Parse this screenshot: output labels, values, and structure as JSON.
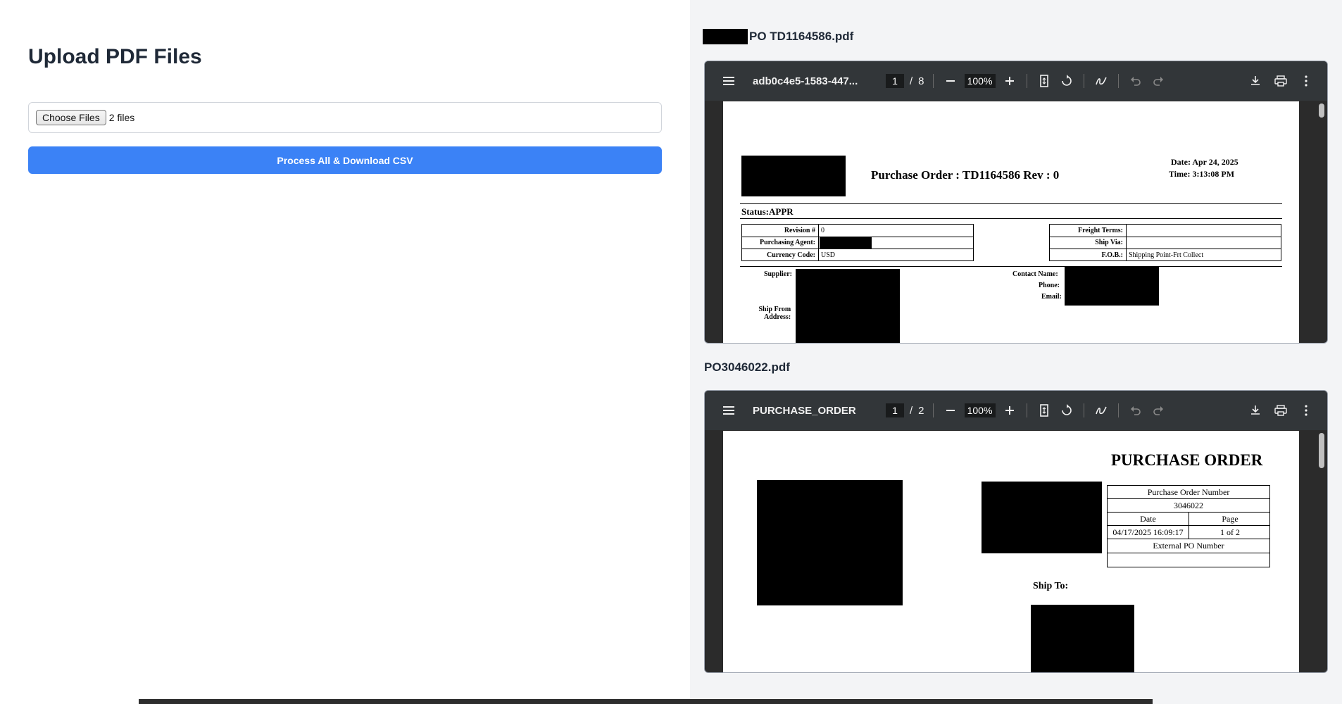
{
  "upload": {
    "title": "Upload PDF Files",
    "choose_label": "Choose Files",
    "file_count": "2 files",
    "process_label": "Process All & Download CSV"
  },
  "pdfs": [
    {
      "name": "PO TD1164586.pdf",
      "toolbar_title": "adb0c4e5-1583-447...",
      "page": "1",
      "page_sep": "/",
      "total": "8",
      "zoom": "100%",
      "doc": {
        "heading": "Purchase Order : TD1164586 Rev : 0",
        "date": "Date: Apr 24, 2025",
        "time": "Time: 3:13:08 PM",
        "status": "Status:APPR",
        "revision_label": "Revision #",
        "revision_value": "0",
        "agent_label": "Purchasing Agent:",
        "currency_label": "Currency Code:",
        "currency_value": "USD",
        "freight_label": "Freight Terms:",
        "shipvia_label": "Ship Via:",
        "fob_label": "F.O.B.:",
        "fob_value": "Shipping Point-Frt Collect",
        "supplier_label": "Supplier:",
        "shipfrom_label1": "Ship From",
        "shipfrom_label2": "Address:",
        "contact_label": "Contact Name:",
        "phone_label": "Phone:",
        "email_label": "Email:"
      }
    },
    {
      "name": "PO3046022.pdf",
      "toolbar_title": "PURCHASE_ORDER",
      "page": "1",
      "page_sep": "/",
      "total": "2",
      "zoom": "100%",
      "doc": {
        "heading": "PURCHASE ORDER",
        "po_number_label": "Purchase Order Number",
        "po_number": "3046022",
        "date_label": "Date",
        "page_label": "Page",
        "date_value": "04/17/2025 16:09:17",
        "page_value": "1 of 2",
        "external_label": "External PO Number",
        "ship_to": "Ship To:"
      }
    }
  ],
  "icons": {
    "menu": "menu-icon",
    "zoom_out": "minus-icon",
    "zoom_in": "plus-icon",
    "fit": "fit-page-icon",
    "rotate": "rotate-icon",
    "annotate": "annotate-icon",
    "undo": "undo-icon",
    "redo": "redo-icon",
    "download": "download-icon",
    "print": "print-icon",
    "more": "more-vert-icon"
  },
  "colors": {
    "accent": "#3b82f6",
    "toolbar": "#323639",
    "right_panel": "#f3f4f6"
  }
}
